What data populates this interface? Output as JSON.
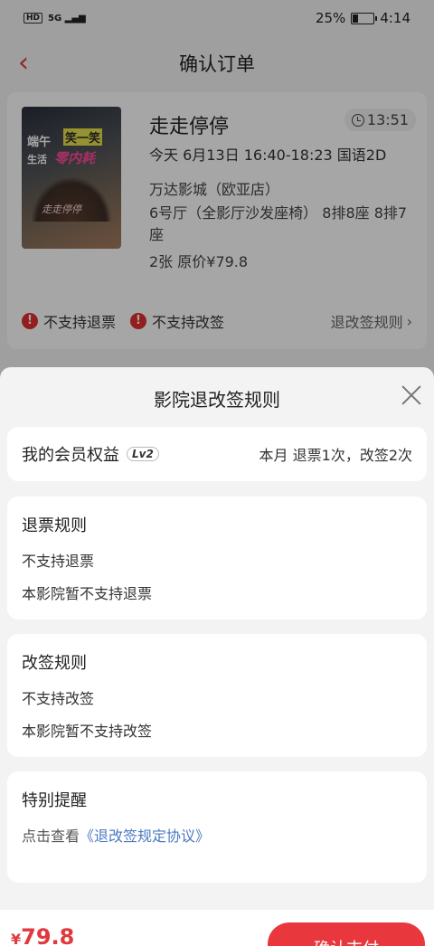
{
  "status_bar": {
    "left": "HD 5G",
    "battery": "25%",
    "time": "4:14"
  },
  "navbar": {
    "back_icon": "chevron-left-icon",
    "title": "确认订单"
  },
  "movie": {
    "poster_text_1": "端午",
    "poster_text_2": "笑一笑",
    "poster_text_3": "生活",
    "poster_text_4": "零内耗",
    "poster_text_5": "走走停停",
    "title": "走走停停",
    "countdown": "13:51",
    "showtime": "今天 6月13日 16:40-18:23 国语2D",
    "cinema": "万达影城（欧亚店）",
    "hall": "6号厅（全影厅沙发座椅） 8排8座 8排7座",
    "price_line": "2张 原价¥79.8",
    "no_refund": "不支持退票",
    "no_change": "不支持改签",
    "rules_link": "退改签规则"
  },
  "sheet": {
    "title": "影院退改签规则",
    "member": {
      "title": "我的会员权益",
      "level": "Lv2",
      "info": "本月 退票1次，改签2次"
    },
    "refund": {
      "title": "退票规则",
      "line1": "不支持退票",
      "line2": "本影院暂不支持退票"
    },
    "change": {
      "title": "改签规则",
      "line1": "不支持改签",
      "line2": "本影院暂不支持改签"
    },
    "notice": {
      "title": "特别提醒",
      "prefix": "点击查看",
      "link": "《退改签规定协议》"
    }
  },
  "bottom": {
    "currency": "¥",
    "total": "79.8",
    "pay_button": "确认支付"
  },
  "colors": {
    "accent": "#e8383e",
    "link": "#4a78c2"
  }
}
